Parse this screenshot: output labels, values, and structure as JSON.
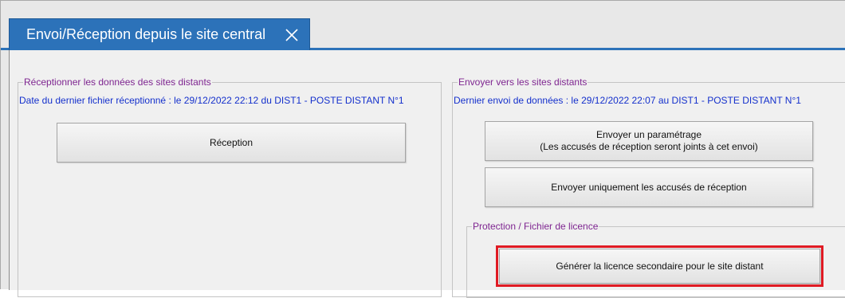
{
  "tab": {
    "title": "Envoi/Réception depuis le site central",
    "close_icon": "close-icon"
  },
  "reception_group": {
    "legend": "Réceptionner les données des sites distants",
    "last_file_info": "Date du dernier fichier réceptionné : le 29/12/2022 22:12 du DIST1 - POSTE DISTANT N°1",
    "reception_button": "Réception"
  },
  "send_group": {
    "legend": "Envoyer vers les sites distants",
    "last_send_info": "Dernier envoi de données : le 29/12/2022 22:07 au DIST1 - POSTE DISTANT N°1",
    "send_config_button": {
      "line1": "Envoyer un paramétrage",
      "line2": "(Les accusés de réception seront joints à cet envoi)"
    },
    "send_receipts_button": "Envoyer uniquement les accusés de réception"
  },
  "license_group": {
    "legend": "Protection / Fichier de licence",
    "generate_button": "Générer la licence secondaire pour le site distant"
  },
  "colors": {
    "tab_blue": "#2c72b9",
    "legend_purple": "#7e2590",
    "info_blue": "#1430cc",
    "highlight_red": "#e01b24"
  }
}
